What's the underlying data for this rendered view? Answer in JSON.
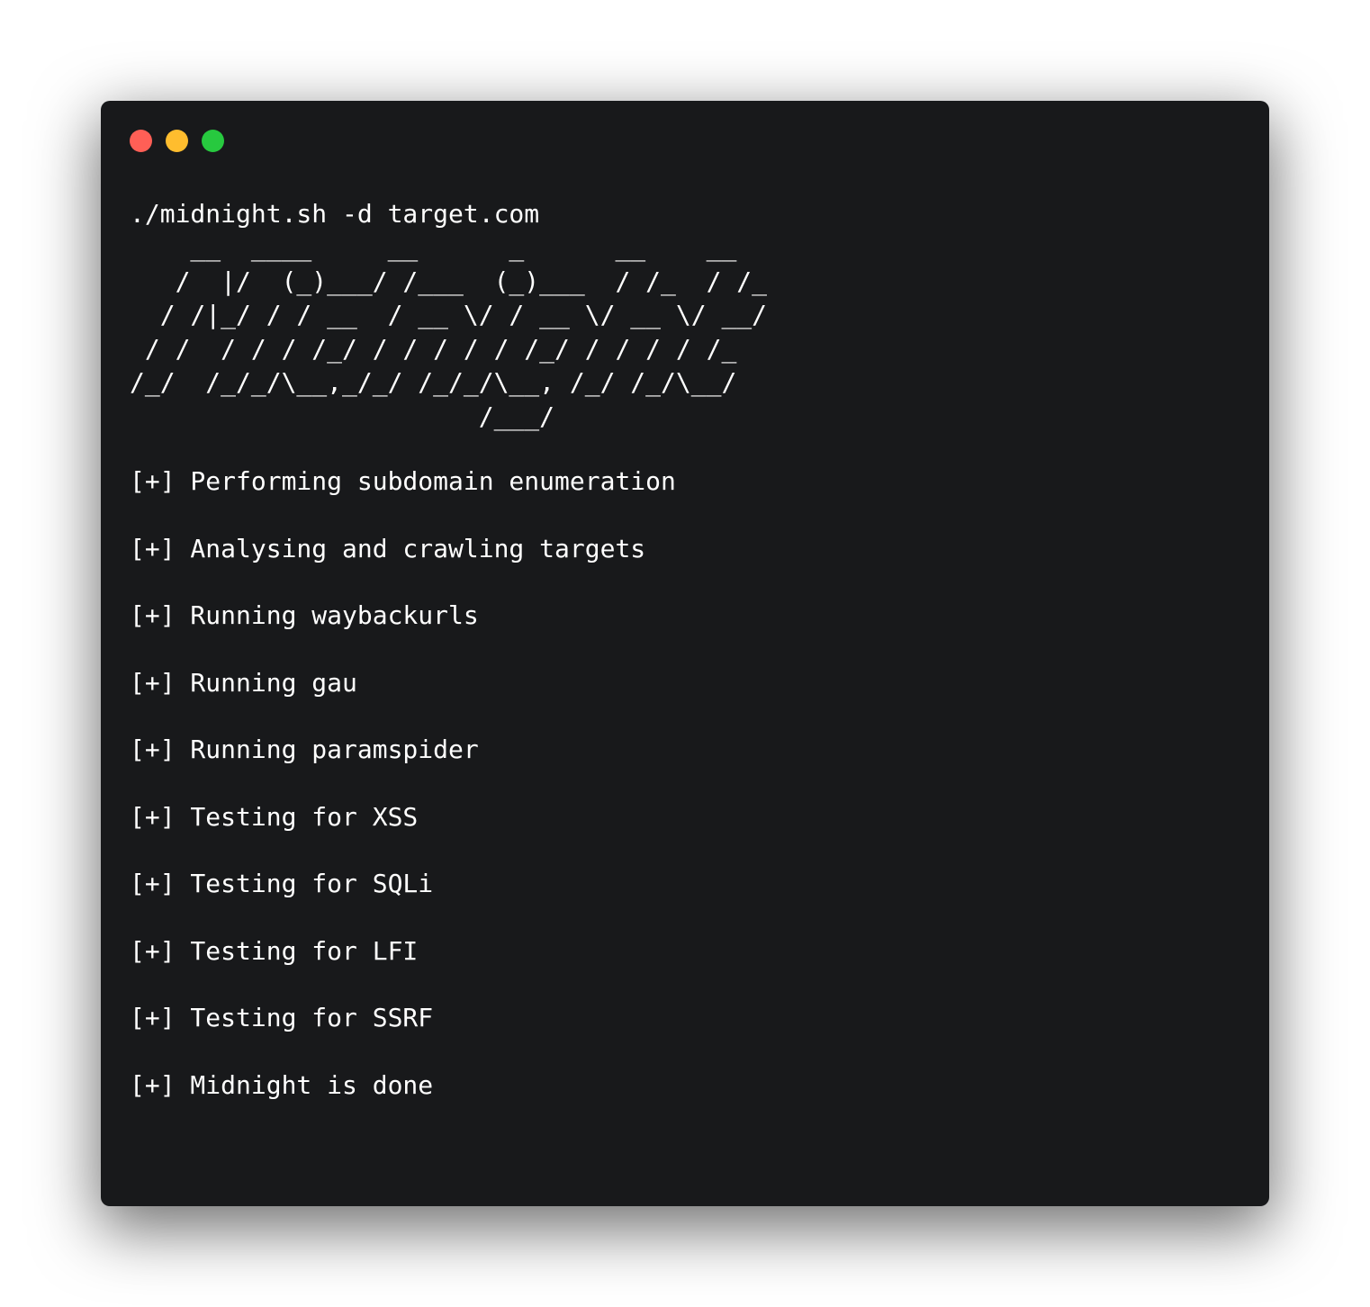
{
  "window": {
    "controls": {
      "close_color": "#ff5f56",
      "minimize_color": "#ffbd2e",
      "zoom_color": "#27c93f"
    }
  },
  "terminal": {
    "command": "./midnight.sh -d target.com",
    "banner": "    __  ____     __      _      __    __\n   /  |/  (_)___/ /___  (_)___  / /_  / /_\n  / /|_/ / / __  / __ \\/ / __ \\/ __ \\/ __/\n / /  / / / /_/ / / / / / /_/ / / / / /_\n/_/  /_/_/\\__,_/_/ /_/_/\\__, /_/ /_/\\__/\n                       /___/",
    "lines": [
      "[+] Performing subdomain enumeration",
      "[+] Analysing and crawling targets",
      "[+] Running waybackurls",
      "[+] Running gau",
      "[+] Running paramspider",
      "[+] Testing for XSS",
      "[+] Testing for SQLi",
      "[+] Testing for LFI",
      "[+] Testing for SSRF",
      "[+] Midnight is done"
    ]
  }
}
